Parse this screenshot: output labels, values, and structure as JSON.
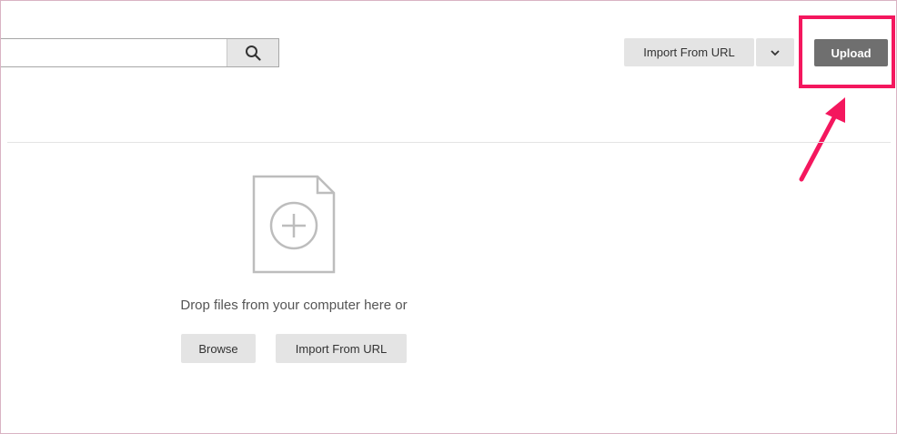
{
  "search": {
    "value": "",
    "placeholder": "",
    "icon": "search-icon"
  },
  "toolbar": {
    "import_label": "Import From URL",
    "dropdown_icon": "chevron-down-icon",
    "upload_label": "Upload"
  },
  "dropzone": {
    "icon": "file-add-icon",
    "text": "Drop files from your computer here or",
    "browse_label": "Browse",
    "import_label": "Import From URL"
  },
  "annotation": {
    "color": "#f4175e"
  },
  "colors": {
    "upload_button": "#6f6f6f",
    "secondary_button": "#e4e4e4"
  }
}
